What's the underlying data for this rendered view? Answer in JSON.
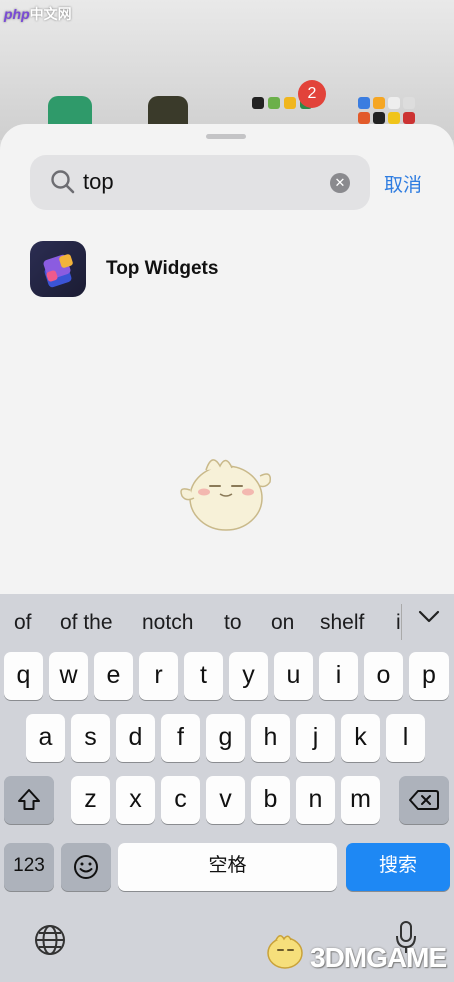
{
  "watermark_top": {
    "php": "php",
    "cn": "中文网"
  },
  "home_badge": "2",
  "search": {
    "value": "top",
    "cancel_label": "取消"
  },
  "results": [
    {
      "name": "Top Widgets"
    }
  ],
  "keyboard": {
    "suggestions": [
      "of",
      "of the",
      "notch",
      "to",
      "on",
      "shelf",
      "i"
    ],
    "row1": [
      "q",
      "w",
      "e",
      "r",
      "t",
      "y",
      "u",
      "i",
      "o",
      "p"
    ],
    "row2": [
      "a",
      "s",
      "d",
      "f",
      "g",
      "h",
      "j",
      "k",
      "l"
    ],
    "row3": [
      "z",
      "x",
      "c",
      "v",
      "b",
      "n",
      "m"
    ],
    "numbers_label": "123",
    "space_label": "空格",
    "search_label": "搜索"
  },
  "watermark": "3DMGAME",
  "colors": {
    "accent": "#2f7de1",
    "search_key": "#1e88f4",
    "badge": "#e2433a"
  }
}
